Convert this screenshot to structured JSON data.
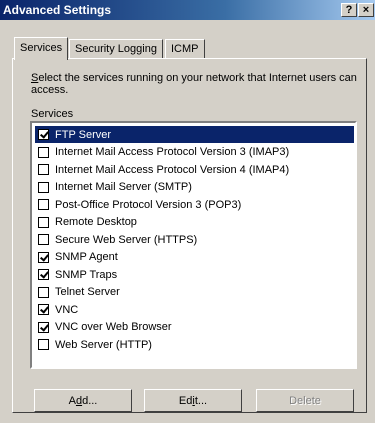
{
  "window": {
    "title": "Advanced Settings",
    "help_label": "?",
    "close_label": "×"
  },
  "tabs": [
    {
      "label": "Services",
      "active": true
    },
    {
      "label": "Security Logging",
      "active": false
    },
    {
      "label": "ICMP",
      "active": false
    }
  ],
  "description": {
    "first_letter": "S",
    "rest": "elect the services running on your network that Internet users can access."
  },
  "services": {
    "label": "Services",
    "items": [
      {
        "label": "FTP Server",
        "checked": true,
        "selected": true
      },
      {
        "label": "Internet Mail Access Protocol Version 3 (IMAP3)",
        "checked": false,
        "selected": false
      },
      {
        "label": "Internet Mail Access Protocol Version 4 (IMAP4)",
        "checked": false,
        "selected": false
      },
      {
        "label": "Internet Mail Server (SMTP)",
        "checked": false,
        "selected": false
      },
      {
        "label": "Post-Office Protocol Version 3 (POP3)",
        "checked": false,
        "selected": false
      },
      {
        "label": "Remote Desktop",
        "checked": false,
        "selected": false
      },
      {
        "label": "Secure Web Server (HTTPS)",
        "checked": false,
        "selected": false
      },
      {
        "label": "SNMP Agent",
        "checked": true,
        "selected": false
      },
      {
        "label": "SNMP Traps",
        "checked": true,
        "selected": false
      },
      {
        "label": "Telnet Server",
        "checked": false,
        "selected": false
      },
      {
        "label": "VNC",
        "checked": true,
        "selected": false
      },
      {
        "label": "VNC over Web Browser",
        "checked": true,
        "selected": false
      },
      {
        "label": "Web Server (HTTP)",
        "checked": false,
        "selected": false
      }
    ]
  },
  "buttons": {
    "add": {
      "label": "Add...",
      "mnemonic": "d"
    },
    "edit": {
      "label": "Edit...",
      "mnemonic": "i"
    },
    "delete": {
      "label": "Delete",
      "disabled": true
    }
  }
}
